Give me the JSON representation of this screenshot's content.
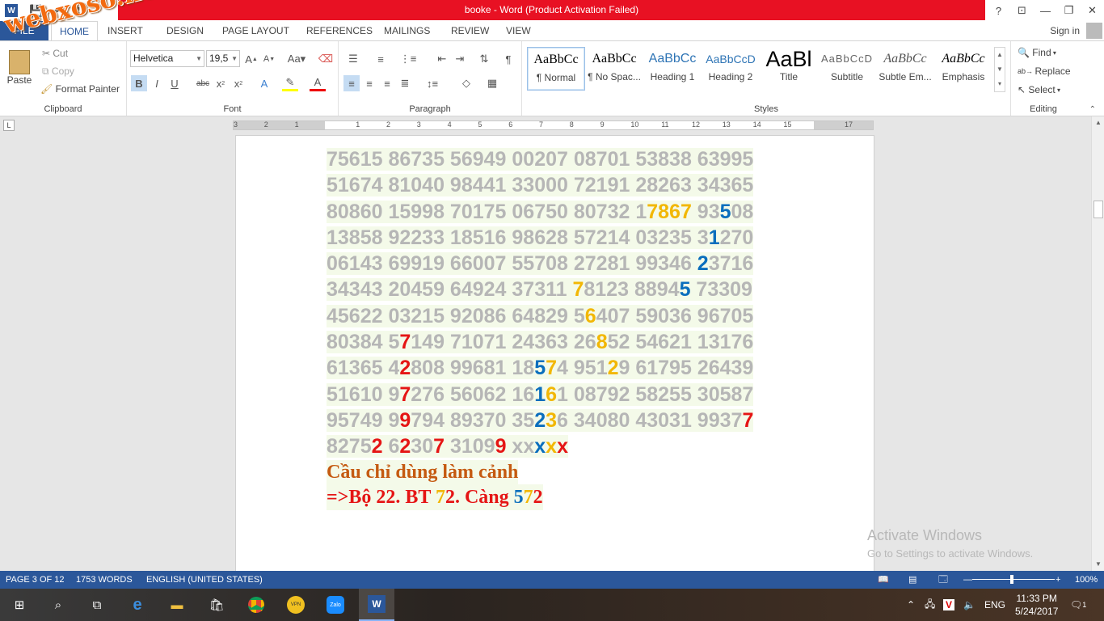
{
  "window": {
    "title": "booke -  Word (Product Activation Failed)",
    "help": "?",
    "controls": [
      "⊡",
      "—",
      "❐",
      "✕"
    ]
  },
  "qat": {
    "word_logo": "W",
    "save": "💾",
    "undo": "↶",
    "redo": "↻",
    "more": "▾"
  },
  "tabs": [
    "FILE",
    "HOME",
    "INSERT",
    "DESIGN",
    "PAGE LAYOUT",
    "REFERENCES",
    "MAILINGS",
    "REVIEW",
    "VIEW"
  ],
  "signin": "Sign in",
  "clipboard": {
    "paste": "Paste",
    "cut": "Cut",
    "copy": "Copy",
    "format_painter": "Format Painter",
    "label": "Clipboard"
  },
  "font": {
    "name": "Helvetica",
    "size": "19,5",
    "label": "Font"
  },
  "paragraph": {
    "label": "Paragraph"
  },
  "styles": {
    "label": "Styles",
    "items": [
      {
        "sample": "AaBbCc",
        "name": "¶ Normal"
      },
      {
        "sample": "AaBbCc",
        "name": "¶ No Spac..."
      },
      {
        "sample": "AaBbCc",
        "name": "Heading 1"
      },
      {
        "sample": "AaBbCcD",
        "name": "Heading 2"
      },
      {
        "sample": "AaBl",
        "name": "Title"
      },
      {
        "sample": "AaBbCcD",
        "name": "Subtitle"
      },
      {
        "sample": "AaBbCc",
        "name": "Subtle Em..."
      },
      {
        "sample": "AaBbCc",
        "name": "Emphasis"
      }
    ]
  },
  "editing": {
    "find": "Find",
    "replace": "Replace",
    "select": "Select",
    "label": "Editing"
  },
  "document": {
    "lines": [
      [
        {
          "t": "75615 86735 56949 00207 08701 53838 63995"
        }
      ],
      [
        {
          "t": "51674 81040 98441 33000 72191 28263 34365"
        }
      ],
      [
        {
          "t": "80860 15998 70175 06750 80732 1"
        },
        {
          "t": "7867",
          "c": "y"
        },
        {
          "t": " 93"
        },
        {
          "t": "5",
          "c": "b"
        },
        {
          "t": "08"
        }
      ],
      [
        {
          "t": "13858 92233 18516 98628 57214 03235 3"
        },
        {
          "t": "1",
          "c": "b"
        },
        {
          "t": "270"
        }
      ],
      [
        {
          "t": "06143 69919 66007 55708 27281 99346 "
        },
        {
          "t": "2",
          "c": "b"
        },
        {
          "t": "3716"
        }
      ],
      [
        {
          "t": "34343 20459 64924 37311 "
        },
        {
          "t": "7",
          "c": "y"
        },
        {
          "t": "8123 8894"
        },
        {
          "t": "5",
          "c": "b"
        },
        {
          "t": " 73309"
        }
      ],
      [
        {
          "t": "45622 03215 92086 64829 5"
        },
        {
          "t": "6",
          "c": "y"
        },
        {
          "t": "407 59036 96705"
        }
      ],
      [
        {
          "t": "80384 5"
        },
        {
          "t": "7",
          "c": "r"
        },
        {
          "t": "149 71071 24363 26"
        },
        {
          "t": "8",
          "c": "y"
        },
        {
          "t": "52 54621 13176"
        }
      ],
      [
        {
          "t": "61365 4"
        },
        {
          "t": "2",
          "c": "r"
        },
        {
          "t": "808 99681 18"
        },
        {
          "t": "5",
          "c": "b"
        },
        {
          "t": "7",
          "c": "y"
        },
        {
          "t": "4 951"
        },
        {
          "t": "2",
          "c": "y"
        },
        {
          "t": "9 61795 26439"
        }
      ],
      [
        {
          "t": "51610 9"
        },
        {
          "t": "7",
          "c": "r"
        },
        {
          "t": "276 56062 16"
        },
        {
          "t": "1",
          "c": "b"
        },
        {
          "t": "6",
          "c": "y"
        },
        {
          "t": "1 08792 58255 30587"
        }
      ],
      [
        {
          "t": "95749 9"
        },
        {
          "t": "9",
          "c": "r"
        },
        {
          "t": "794 89370 35"
        },
        {
          "t": "2",
          "c": "b"
        },
        {
          "t": "3",
          "c": "y"
        },
        {
          "t": "6 34080 43031 9937"
        },
        {
          "t": "7",
          "c": "r"
        }
      ],
      [
        {
          "t": "8275"
        },
        {
          "t": "2",
          "c": "r"
        },
        {
          "t": " 6"
        },
        {
          "t": "2",
          "c": "r"
        },
        {
          "t": "30"
        },
        {
          "t": "7",
          "c": "r"
        },
        {
          "t": " 3109"
        },
        {
          "t": "9",
          "c": "r"
        },
        {
          "t": " xx"
        },
        {
          "t": "x",
          "c": "b"
        },
        {
          "t": "x",
          "c": "y"
        },
        {
          "t": "x",
          "c": "r"
        }
      ]
    ],
    "note1": "Cầu chỉ dùng làm cảnh",
    "note2_parts": [
      {
        "t": "=>Bộ 22. BT "
      },
      {
        "t": "7",
        "c": "y"
      },
      {
        "t": "2. Càng "
      },
      {
        "t": "5",
        "c": "b"
      },
      {
        "t": "7",
        "c": "y"
      },
      {
        "t": "2"
      }
    ]
  },
  "activate": {
    "line1": "Activate Windows",
    "line2": "Go to Settings to activate Windows."
  },
  "status": {
    "page": "PAGE 3 OF 12",
    "words": "1753 WORDS",
    "language": "ENGLISH (UNITED STATES)",
    "zoom": "100%"
  },
  "taskbar": {
    "lang": "ENG",
    "time": "11:33 PM",
    "date": "5/24/2017",
    "notif": "1"
  },
  "watermark": "webxoso.net",
  "colors": {
    "word_blue": "#2b579a",
    "title_red": "#e81123",
    "yellow": "#f2b705",
    "blue": "#0a6ebd",
    "red": "#e51515"
  }
}
